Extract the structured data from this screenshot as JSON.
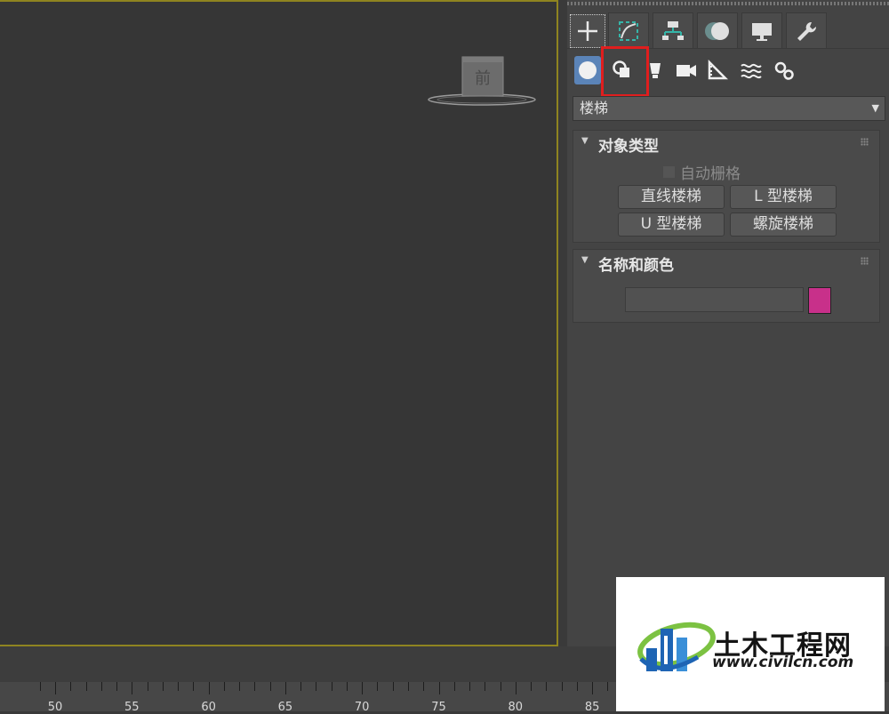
{
  "viewport": {
    "viewcube_label": "前"
  },
  "command_panel": {
    "main_tabs": [
      {
        "name": "create",
        "icon": "plus-icon"
      },
      {
        "name": "modify",
        "icon": "modify-curve-icon"
      },
      {
        "name": "hierarchy",
        "icon": "hierarchy-icon"
      },
      {
        "name": "motion",
        "icon": "motion-icon"
      },
      {
        "name": "display",
        "icon": "monitor-icon"
      },
      {
        "name": "utilities",
        "icon": "wrench-icon"
      }
    ],
    "sub_tabs": [
      {
        "name": "geometry",
        "icon": "sphere-icon",
        "active": true
      },
      {
        "name": "shapes",
        "icon": "shapes-icon",
        "highlighted": true
      },
      {
        "name": "lights",
        "icon": "light-icon"
      },
      {
        "name": "cameras",
        "icon": "camera-icon"
      },
      {
        "name": "helpers",
        "icon": "ruler-icon"
      },
      {
        "name": "space-warps",
        "icon": "waves-icon"
      },
      {
        "name": "systems",
        "icon": "gears-icon"
      }
    ],
    "category": "楼梯",
    "object_type": {
      "title": "对象类型",
      "autogrid_label": "自动栅格",
      "buttons": [
        "直线楼梯",
        "L 型楼梯",
        "U 型楼梯",
        "螺旋楼梯"
      ]
    },
    "name_color": {
      "title": "名称和颜色",
      "name_value": "",
      "color": "#c8308a"
    }
  },
  "timeline": {
    "ticks": [
      "50",
      "55",
      "60",
      "65",
      "70",
      "75",
      "80",
      "85"
    ]
  },
  "watermark": {
    "title": "土木工程网",
    "url": "www.civilcn.com"
  },
  "colors": {
    "accent_active": "#5b84b8",
    "highlight": "#e01e1e",
    "viewport_border": "#8f8420"
  }
}
